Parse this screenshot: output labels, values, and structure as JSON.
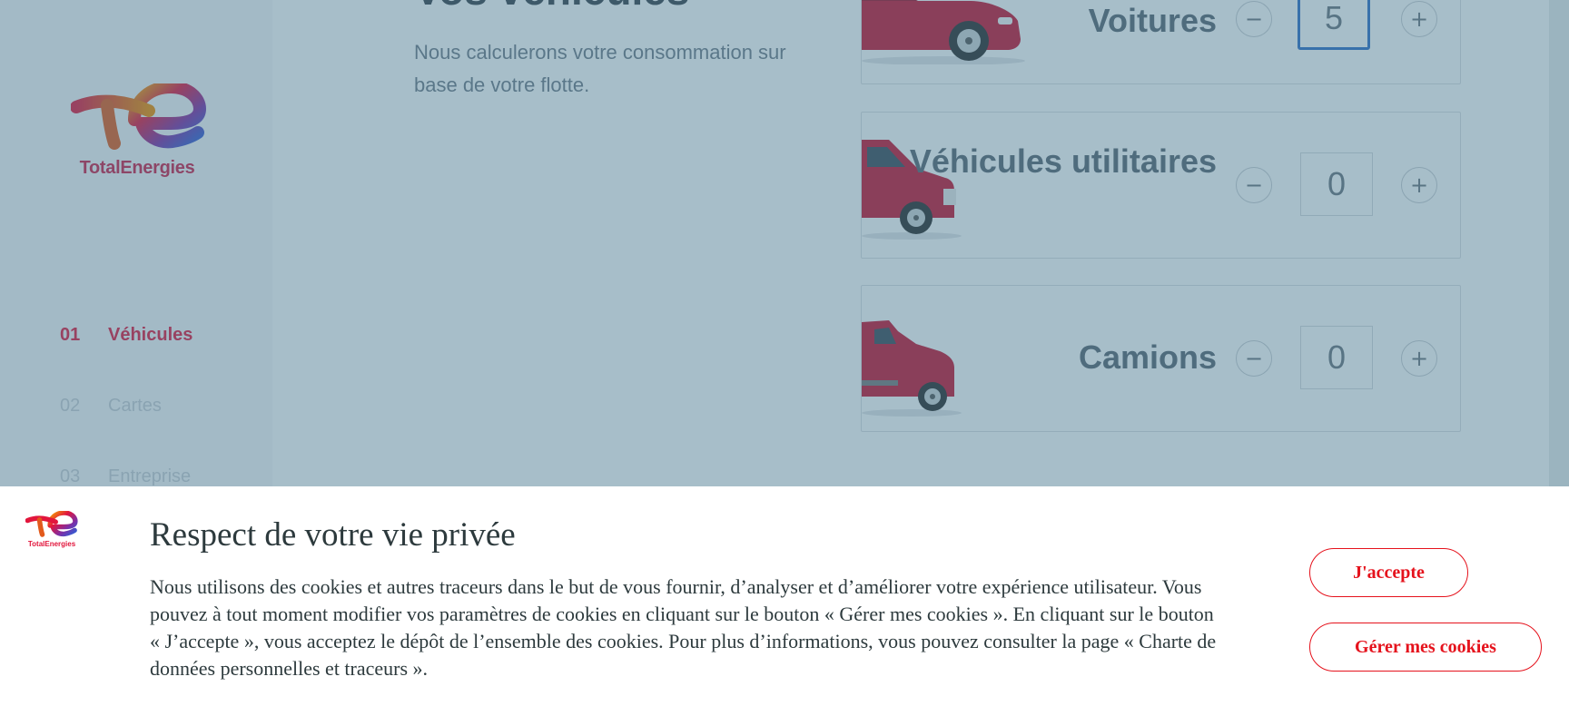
{
  "brand": {
    "name": "TotalEnergies",
    "accent": "#e2163c"
  },
  "steps": [
    {
      "num": "01",
      "label": "Véhicules",
      "active": true
    },
    {
      "num": "02",
      "label": "Cartes",
      "active": false
    },
    {
      "num": "03",
      "label": "Entreprise",
      "active": false
    }
  ],
  "main": {
    "title": "Vos véhicules",
    "subtitle": "Nous calculerons votre consommation sur base de votre flotte."
  },
  "vehicles": [
    {
      "label": "Voitures",
      "quantity": "5",
      "minus": "−",
      "plus": "+",
      "icon": "car-icon"
    },
    {
      "label": "Véhicules utilitaires",
      "quantity": "0",
      "minus": "−",
      "plus": "+",
      "icon": "van-icon"
    },
    {
      "label": "Camions",
      "quantity": "0",
      "minus": "−",
      "plus": "+",
      "icon": "truck-icon"
    }
  ],
  "cookie_banner": {
    "title": "Respect de votre vie privée",
    "text": "Nous utilisons des cookies et autres traceurs dans le but de vous fournir, d’analyser et d’améliorer votre expérience utilisateur. Vous pouvez à tout moment modifier vos paramètres de cookies en cliquant sur le bouton « Gérer mes cookies ». En cliquant sur le bouton « J’accepte », vous acceptez le dépôt de l’ensemble des cookies. Pour plus d’informations, vous pouvez consulter la page « Charte de données personnelles et traceurs ».",
    "accept_label": "J'accepte",
    "manage_label": "Gérer mes cookies",
    "logo_text": "TotalEnergies"
  }
}
